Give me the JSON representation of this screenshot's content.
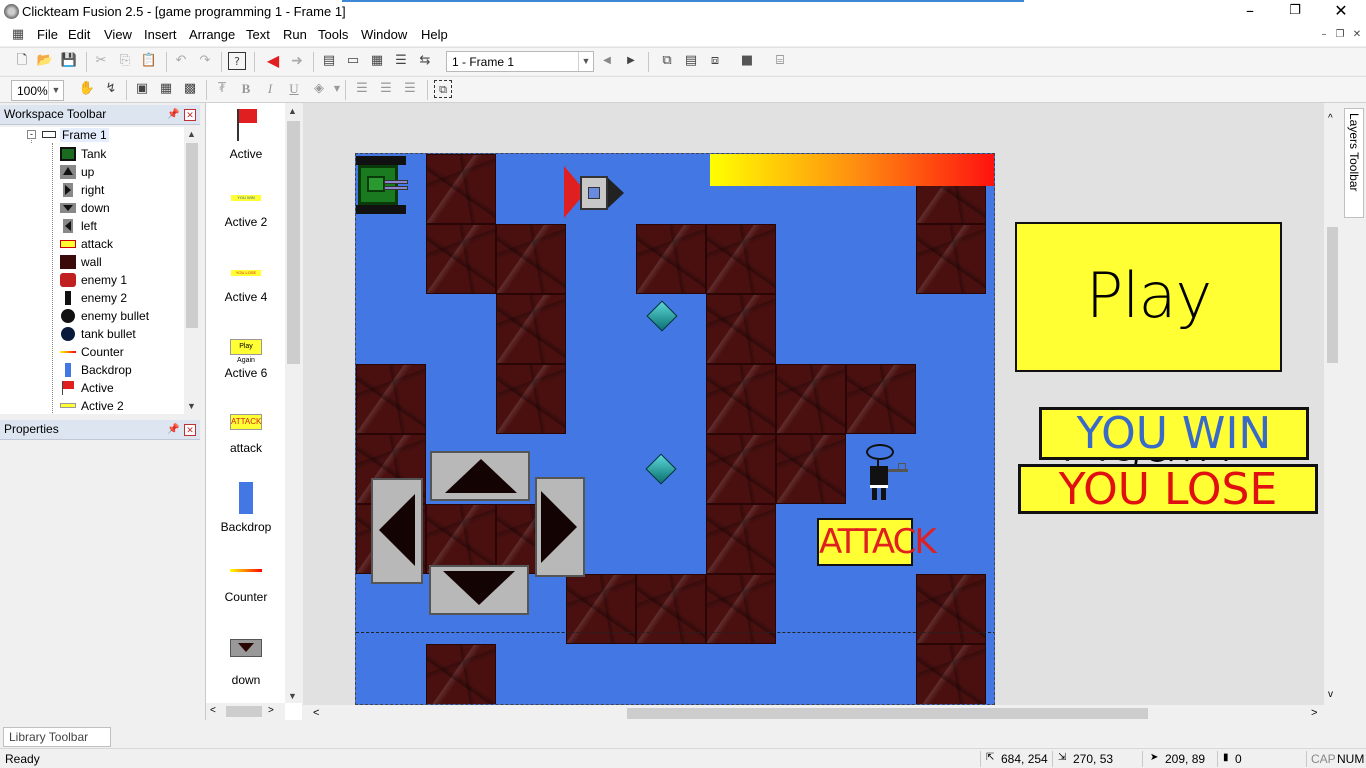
{
  "window": {
    "title": "Clickteam Fusion 2.5 - [game programming 1 - Frame 1]",
    "minimize": "–",
    "restore": "❐",
    "close": "✕"
  },
  "menu": [
    "File",
    "Edit",
    "View",
    "Insert",
    "Arrange",
    "Text",
    "Run",
    "Tools",
    "Window",
    "Help"
  ],
  "toolbar": {
    "frame_select": "1 - Frame 1",
    "zoom": "100%"
  },
  "text_format": {
    "bold": "B",
    "italic": "I",
    "underline": "U"
  },
  "workspace": {
    "title": "Workspace Toolbar",
    "frame_label": "Frame 1",
    "items": [
      "Tank",
      "up",
      "right",
      "down",
      "left",
      "attack",
      "wall",
      "enemy 1",
      "enemy 2",
      "enemy bullet",
      "tank bullet",
      "Counter",
      "Backdrop",
      "Active",
      "Active 2"
    ]
  },
  "properties": {
    "title": "Properties"
  },
  "objects": {
    "labels": [
      "Active",
      "Active 2",
      "Active 4",
      "Active 6",
      "attack",
      "Backdrop",
      "Counter",
      "down"
    ]
  },
  "scene": {
    "play_again": "Play Again",
    "you_win": "YOU WIN",
    "you_lose": "YOU LOSE",
    "attack": "ATTACK",
    "mini_you_win": "YOU WIN",
    "mini_you_lose": "YOU LOSE",
    "mini_play_again": "Play Again",
    "mini_attack": "ATTACK"
  },
  "layers": {
    "label": "Layers Toolbar"
  },
  "library": {
    "label": "Library Toolbar"
  },
  "status": {
    "ready": "Ready",
    "pos": "684, 254",
    "size": "270, 53",
    "cursor": "209, 89",
    "count": "0",
    "caps": "CAP",
    "num": "NUM"
  },
  "colors": {
    "frame_bg": "#4277e4",
    "wall": "#4a1010",
    "yellow": "#ffff33"
  }
}
